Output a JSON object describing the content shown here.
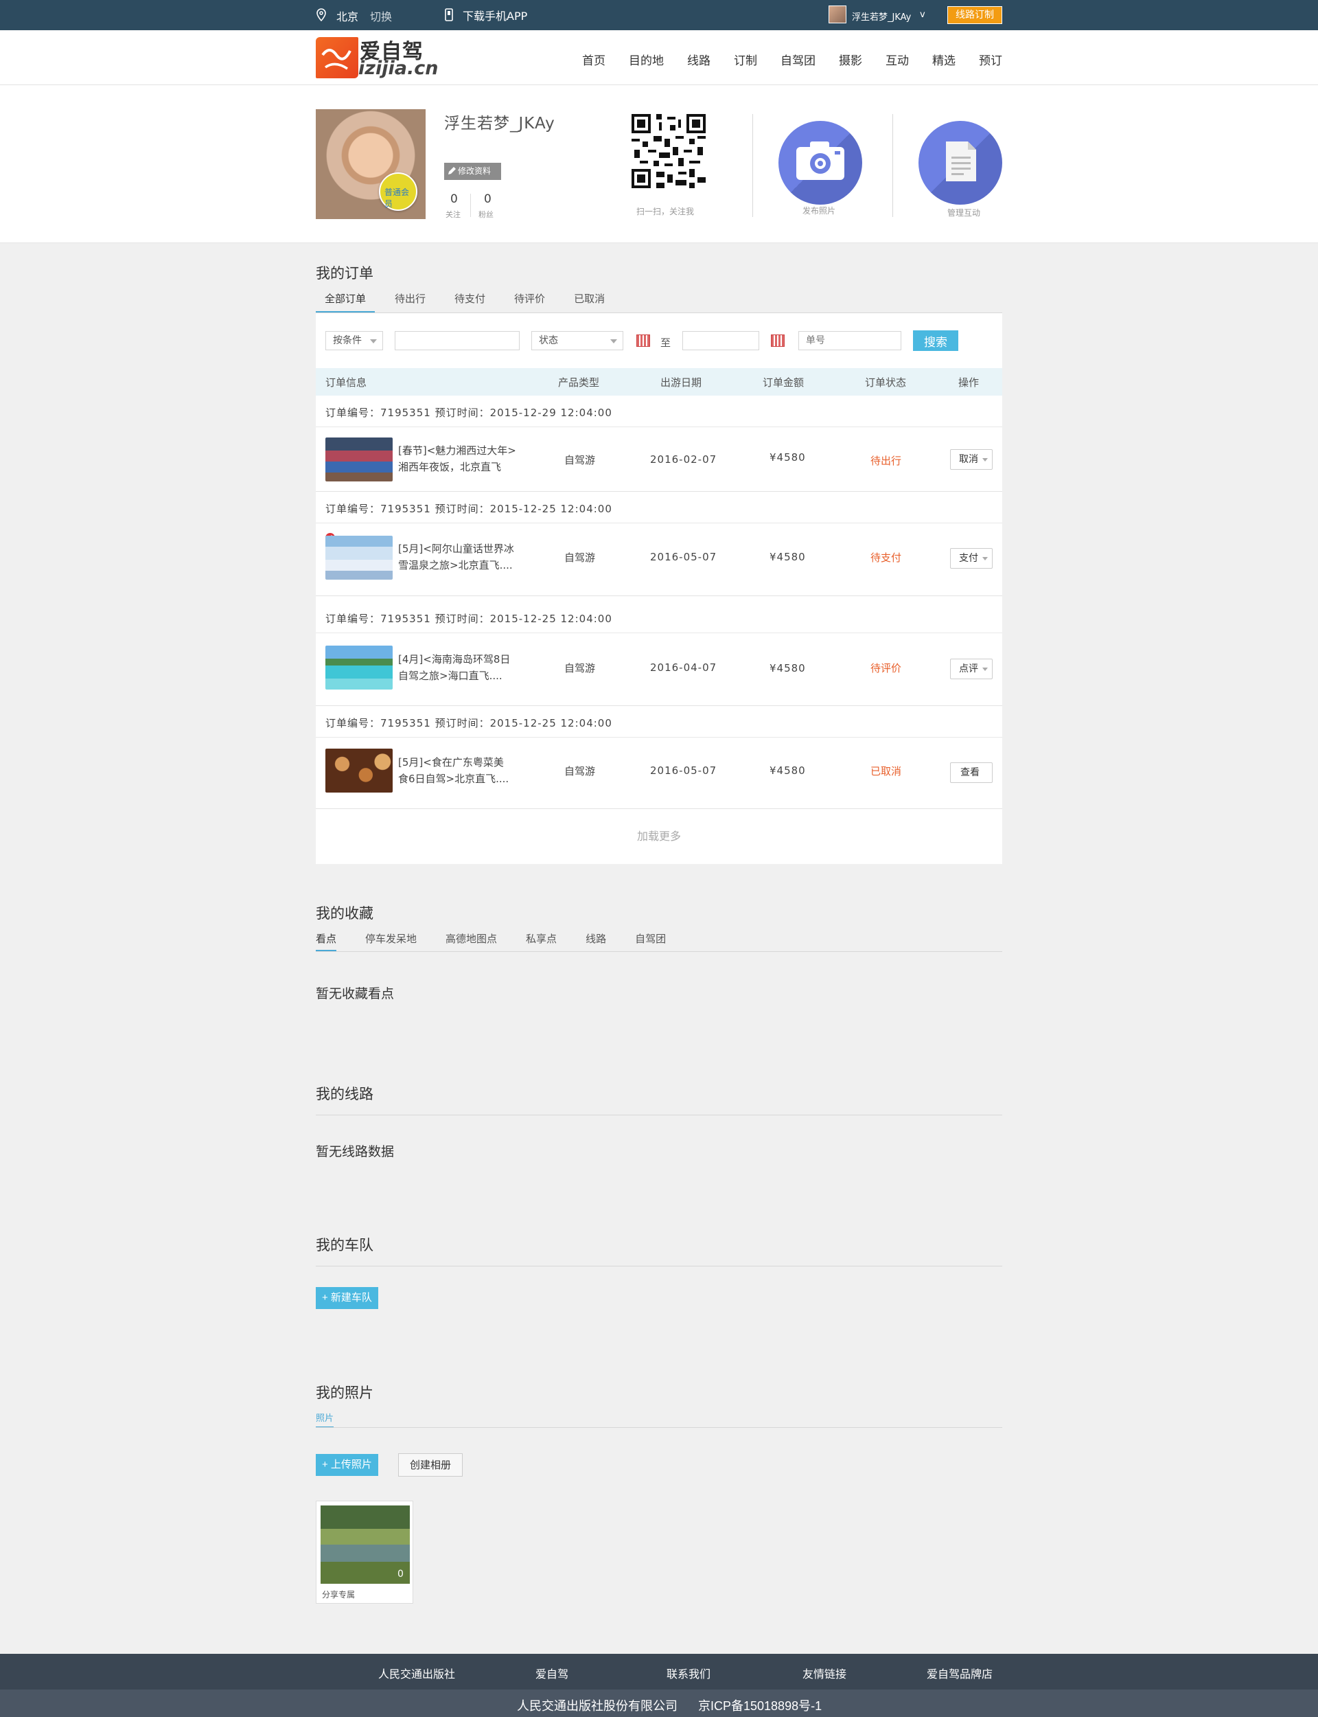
{
  "topbar": {
    "city": "北京",
    "switch": "切换",
    "app": "下载手机APP",
    "username": "浮生若梦_JKAy",
    "caret": "v",
    "custom_btn": "线路订制"
  },
  "header": {
    "logo_cn": "爱自驾",
    "logo_en": "izijia.cn",
    "nav": [
      "首页",
      "目的地",
      "线路",
      "订制",
      "自驾团",
      "摄影",
      "互动",
      "精选",
      "预订"
    ]
  },
  "profile": {
    "name": "浮生若梦_JKAy",
    "edit": "修改资料",
    "member": "普通会员",
    "follow_count": "0",
    "follow_label": "关注",
    "fans_count": "0",
    "fans_label": "粉丝",
    "qr_caption": "扫一扫，关注我",
    "publish_photo": "发布照片",
    "manage": "管理互动"
  },
  "orders": {
    "title": "我的订单",
    "tabs": [
      "全部订单",
      "待出行",
      "待支付",
      "待评价",
      "已取消"
    ],
    "filter": {
      "condition": "按条件",
      "status": "状态",
      "to": "至",
      "order_no_placeholder": "单号",
      "search": "搜索"
    },
    "columns": [
      "订单信息",
      "产品类型",
      "出游日期",
      "订单金额",
      "订单状态",
      "操作"
    ],
    "rows": [
      {
        "head": "订单编号：7195351 预订时间：2015-12-29 12:04:00",
        "name1": "[春节]<魅力湘西过大年>",
        "name2": "湘西年夜饭，北京直飞",
        "type": "自驾游",
        "date": "2016-02-07",
        "amount": "¥4580",
        "status": "待出行",
        "op": "取消"
      },
      {
        "head": "订单编号：7195351 预订时间：2015-12-25 12:04:00",
        "name1": "[5月]<阿尔山童话世界冰",
        "name2": "雪温泉之旅>北京直飞....",
        "type": "自驾游",
        "date": "2016-05-07",
        "amount": "¥4580",
        "status": "待支付",
        "op": "支付"
      },
      {
        "head": "订单编号：7195351 预订时间：2015-12-25 12:04:00",
        "name1": "[4月]<海南海岛环驾8日",
        "name2": "自驾之旅>海口直飞....",
        "type": "自驾游",
        "date": "2016-04-07",
        "amount": "¥4580",
        "status": "待评价",
        "op": "点评"
      },
      {
        "head": "订单编号：7195351 预订时间：2015-12-25 12:04:00",
        "name1": "[5月]<食在广东粤菜美",
        "name2": "食6日自驾>北京直飞....",
        "type": "自驾游",
        "date": "2016-05-07",
        "amount": "¥4580",
        "status": "已取消",
        "op": "查看"
      }
    ],
    "load_more": "加载更多"
  },
  "favorites": {
    "title": "我的收藏",
    "tabs": [
      "看点",
      "停车发呆地",
      "高德地图点",
      "私享点",
      "线路",
      "自驾团"
    ],
    "empty": "暂无收藏看点"
  },
  "routes": {
    "title": "我的线路",
    "empty": "暂无线路数据"
  },
  "team": {
    "title": "我的车队",
    "new_btn": "+ 新建车队"
  },
  "photos": {
    "title": "我的照片",
    "tab": "照片",
    "upload_btn": "+ 上传照片",
    "album_btn": "创建相册",
    "album_name": "分享专属",
    "album_count": "0"
  },
  "footer": {
    "links": [
      "人民交通出版社",
      "爱自驾",
      "联系我们",
      "友情链接",
      "爱自驾品牌店"
    ],
    "company": "人民交通出版社股份有限公司",
    "icp": "京ICP备15018898号-1"
  },
  "colors": {
    "topbar": "#2d4b5f",
    "accent": "#4ab8e0",
    "status": "#e8602c",
    "orange": "#f39c12",
    "circle": "#6c7fe0"
  }
}
